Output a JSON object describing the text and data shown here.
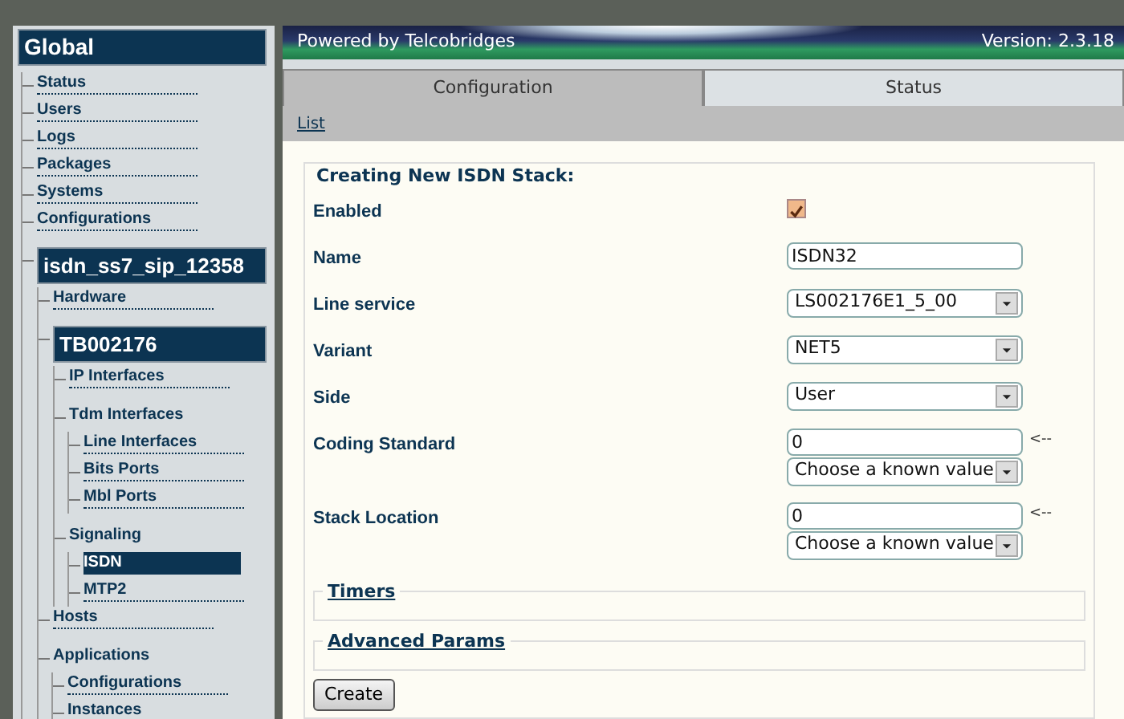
{
  "sidebar": {
    "title": "Global",
    "items": [
      {
        "label": "Status",
        "kind": "link",
        "selected": false
      },
      {
        "label": "Users",
        "kind": "link",
        "selected": false
      },
      {
        "label": "Logs",
        "kind": "link",
        "selected": false
      },
      {
        "label": "Packages",
        "kind": "link",
        "selected": false
      },
      {
        "label": "Systems",
        "kind": "link",
        "selected": false
      },
      {
        "label": "Configurations",
        "kind": "link",
        "selected": false
      },
      {
        "label": "isdn_ss7_sip_12358",
        "kind": "header",
        "selected": false,
        "children": [
          {
            "label": "Hardware",
            "kind": "link",
            "selected": false
          },
          {
            "label": "TB002176",
            "kind": "header",
            "selected": false,
            "children": [
              {
                "label": "IP Interfaces",
                "kind": "link",
                "selected": false
              },
              {
                "label": "Tdm Interfaces",
                "kind": "group",
                "selected": false,
                "children": [
                  {
                    "label": "Line Interfaces",
                    "kind": "link",
                    "selected": false
                  },
                  {
                    "label": "Bits Ports",
                    "kind": "link",
                    "selected": false
                  },
                  {
                    "label": "Mbl Ports",
                    "kind": "link",
                    "selected": false
                  }
                ]
              },
              {
                "label": "Signaling",
                "kind": "group",
                "selected": false,
                "children": [
                  {
                    "label": "ISDN",
                    "kind": "link",
                    "selected": true
                  },
                  {
                    "label": "MTP2",
                    "kind": "link",
                    "selected": false
                  }
                ]
              }
            ]
          },
          {
            "label": "Hosts",
            "kind": "link",
            "selected": false
          },
          {
            "label": "Applications",
            "kind": "group",
            "selected": false,
            "children": [
              {
                "label": "Configurations",
                "kind": "link",
                "selected": false
              },
              {
                "label": "Instances",
                "kind": "link",
                "selected": false
              }
            ]
          }
        ]
      }
    ]
  },
  "banner": {
    "left": "Powered by Telcobridges",
    "right": "Version: 2.3.18"
  },
  "tabs": [
    {
      "label": "Configuration",
      "selected": true
    },
    {
      "label": "Status",
      "selected": false
    }
  ],
  "subnav": {
    "link": "List"
  },
  "form": {
    "legend": "Creating New ISDN Stack:",
    "fields": [
      {
        "label": "Enabled",
        "kind": "checkbox",
        "checked": true
      },
      {
        "label": "Name",
        "kind": "text",
        "value": "ISDN32"
      },
      {
        "label": "Line service",
        "kind": "select",
        "value": "LS002176E1_5_00"
      },
      {
        "label": "Variant",
        "kind": "select",
        "value": "NET5"
      },
      {
        "label": "Side",
        "kind": "select",
        "value": "User"
      },
      {
        "label": "Coding Standard",
        "kind": "combo",
        "value": "0",
        "hint": "<--",
        "choice": "Choose a known value"
      },
      {
        "label": "Stack Location",
        "kind": "combo",
        "value": "0",
        "hint": "<--",
        "choice": "Choose a known value"
      }
    ],
    "sections": [
      "Timers",
      "Advanced Params"
    ],
    "submit": "Create"
  }
}
